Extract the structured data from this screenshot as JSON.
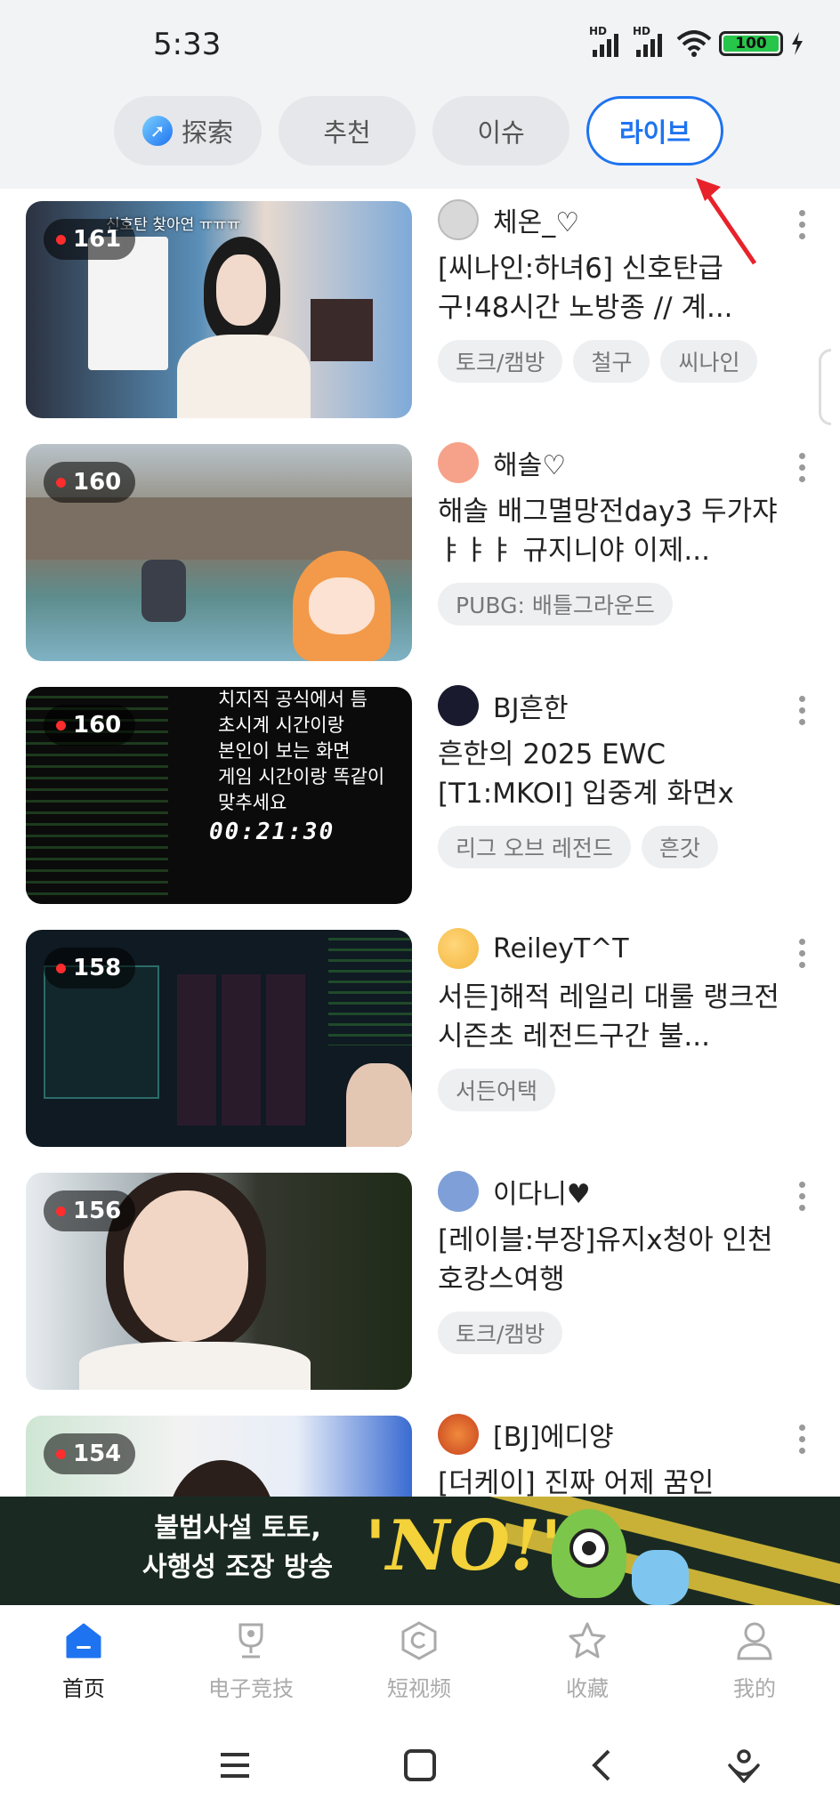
{
  "status_bar": {
    "time": "5:33",
    "signal1_label": "HD",
    "signal2_label": "HD",
    "battery": "100"
  },
  "tabs": [
    {
      "label": "探索",
      "icon": "compass-icon",
      "active": false
    },
    {
      "label": "추천",
      "active": false
    },
    {
      "label": "이슈",
      "active": false
    },
    {
      "label": "라이브",
      "active": true
    }
  ],
  "streams": [
    {
      "viewers": "161",
      "streamer": "체온_♡",
      "title": "[씨나인:하녀6] 신호탄급구!48시간 노방종 // 계...",
      "tags": [
        "토크/캠방",
        "철구",
        "씨나인"
      ],
      "thumb_overlay": "신호탄 찾아연 ㅠㅠㅠ",
      "avatar_color": "#d8d8d8"
    },
    {
      "viewers": "160",
      "streamer": "해솔♡",
      "title": "해솔 배그멸망전day3 두가쟈ㅑㅑㅑ 규지니야 이제...",
      "tags": [
        "PUBG: 배틀그라운드"
      ],
      "avatar_color": "#f6a28a"
    },
    {
      "viewers": "160",
      "streamer": "BJ흔한",
      "title": "흔한의 2025 EWC [T1:MKOI] 입중계 화면x",
      "tags": [
        "리그 오브 레전드",
        "흔갓"
      ],
      "thumb_overlay_lines": [
        "치지직 공식에서 틈",
        "초시계 시간이랑",
        "본인이 보는 화면",
        "게임 시간이랑 똑같이",
        "맞추세요"
      ],
      "thumb_timer": "00:21:30",
      "avatar_color": "#1a1a2e"
    },
    {
      "viewers": "158",
      "streamer": "ReileyT^T",
      "title": "서든]해적 레일리 대룰 랭크전 시즌초 레전드구간 불...",
      "tags": [
        "서든어택"
      ],
      "avatar_color": "#f3b53d"
    },
    {
      "viewers": "156",
      "streamer": "이다니♥",
      "title": "[레이블:부장]유지x청아 인천 호캉스여행",
      "tags": [
        "토크/캠방"
      ],
      "avatar_color": "#7f9fd8"
    },
    {
      "viewers": "154",
      "streamer": "[BJ]에디양",
      "title": "[더케이] 진짜 어제 꿈인",
      "tags": [],
      "avatar_color": "#c8421f"
    }
  ],
  "banner": {
    "line1": "불법사설 토토,",
    "line2": "사행성 조장 방송",
    "slogan": "'NO!'"
  },
  "bottom_nav": [
    {
      "label": "首页",
      "icon": "home-icon",
      "active": true
    },
    {
      "label": "电子竞技",
      "icon": "trophy-icon",
      "active": false
    },
    {
      "label": "短视频",
      "icon": "short-video-icon",
      "active": false
    },
    {
      "label": "收藏",
      "icon": "star-icon",
      "active": false
    },
    {
      "label": "我的",
      "icon": "profile-icon",
      "active": false
    }
  ],
  "colors": {
    "accent": "#1e73f0",
    "live_dot": "#ff2d2d",
    "arrow": "#e8222a"
  }
}
